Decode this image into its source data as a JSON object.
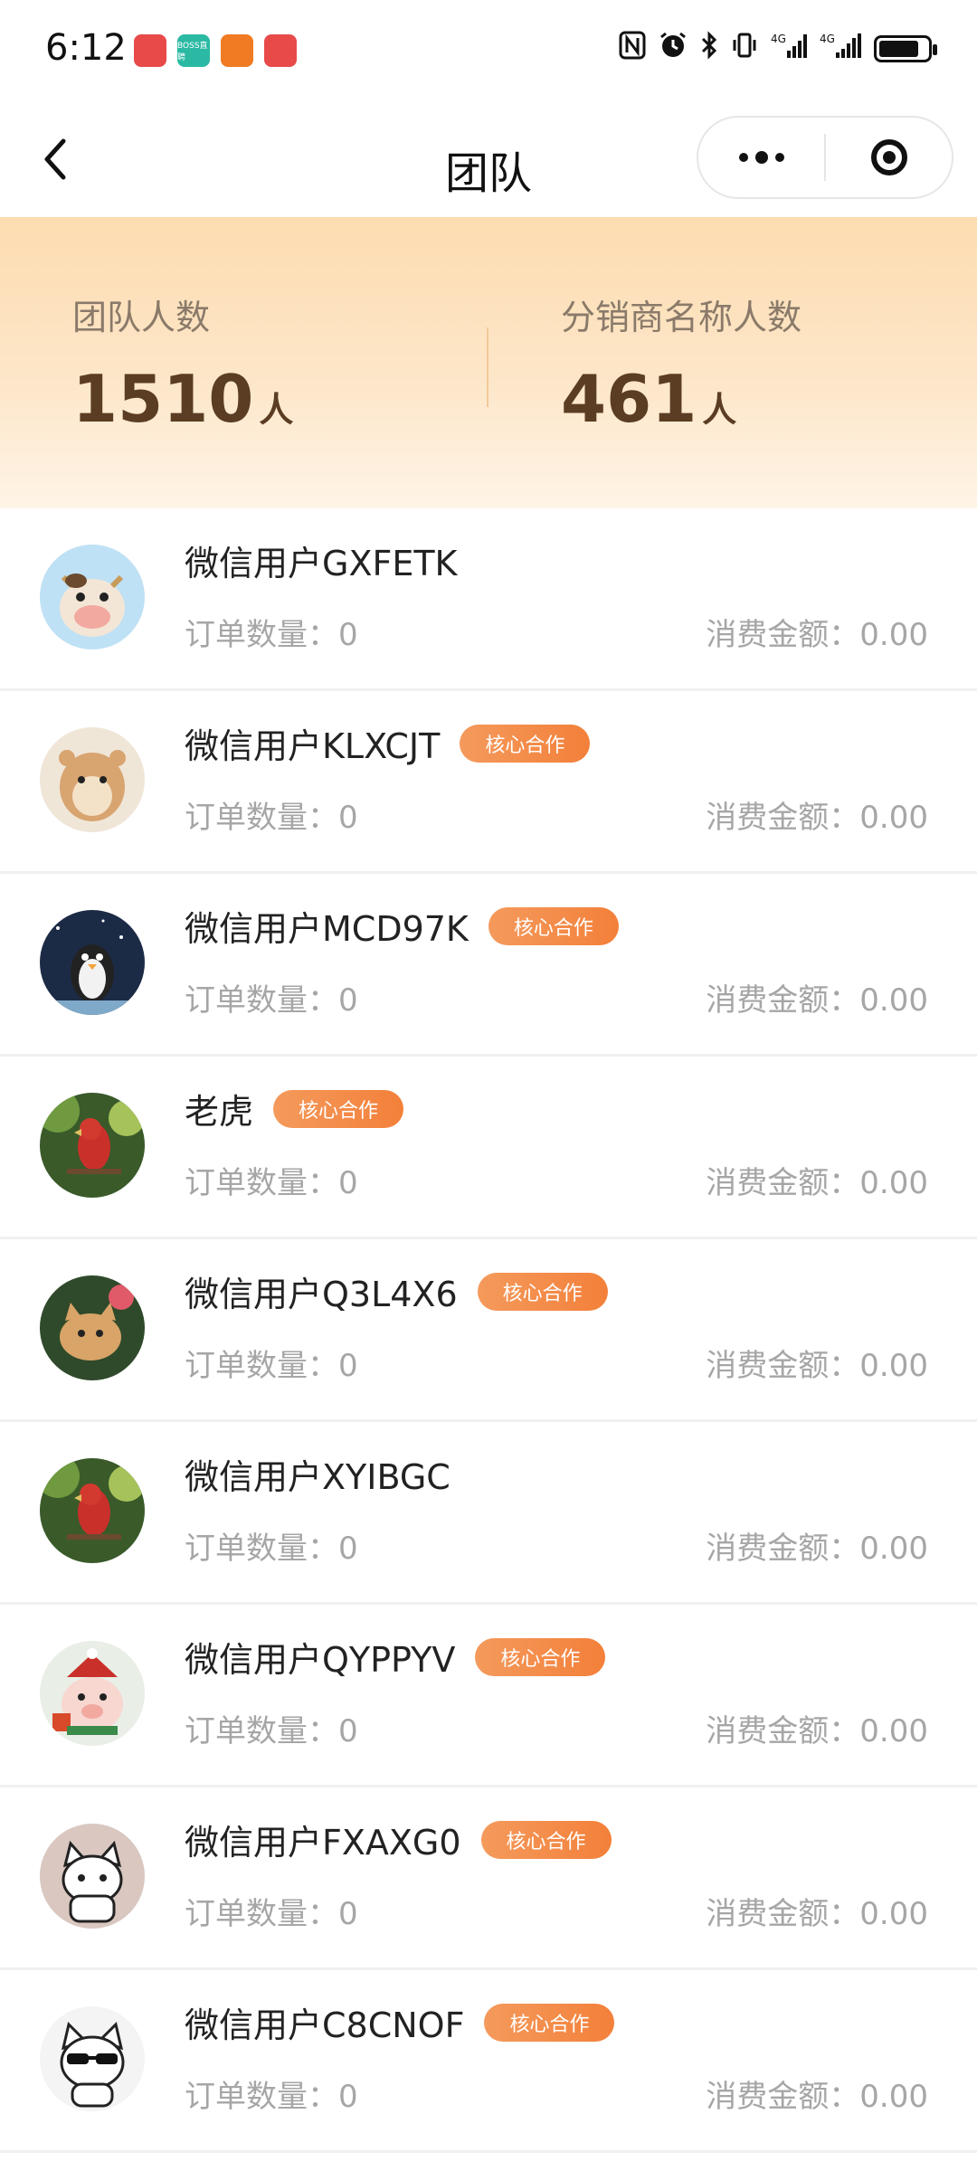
{
  "status_bar": {
    "time": "6:12",
    "apps": [
      {
        "name": "red-app",
        "color": "#e84a4a",
        "text": ""
      },
      {
        "name": "boss-app",
        "color": "#2bb9a3",
        "text": "BOSS直聘"
      },
      {
        "name": "orange-app",
        "color": "#f07b22",
        "text": ""
      },
      {
        "name": "huawei-app",
        "color": "#e84a4a",
        "text": ""
      }
    ],
    "signal_1": "4G",
    "signal_2": "4G",
    "battery_level": 0.8
  },
  "nav": {
    "title": "团队"
  },
  "summary": {
    "team_label": "团队人数",
    "team_value": "1510",
    "team_unit": "人",
    "dist_label": "分销商名称人数",
    "dist_value": "461",
    "dist_unit": "人"
  },
  "labels": {
    "orders": "订单数量：",
    "amount": "消费金额："
  },
  "members": [
    {
      "name": "微信用户GXFETK",
      "badge": "",
      "orders_label": "订单数量：",
      "orders": "0",
      "amount_label": "消费金额：",
      "amount": "0.00",
      "avatar": "cow-avatar"
    },
    {
      "name": "微信用户KLXCJT",
      "badge": "核心合作",
      "orders_label": "订单数量：",
      "orders": "0",
      "amount_label": "消费金额：",
      "amount": "0.00",
      "avatar": "hamster-avatar"
    },
    {
      "name": "微信用户MCD97K",
      "badge": "核心合作",
      "orders_label": "订单数量：",
      "orders": "0",
      "amount_label": "消费金额：",
      "amount": "0.00",
      "avatar": "penguin-avatar"
    },
    {
      "name": "老虎",
      "badge": "核心合作",
      "orders_label": "订单数量：",
      "orders": "0",
      "amount_label": "消费金额：",
      "amount": "0.00",
      "avatar": "parrot-avatar"
    },
    {
      "name": "微信用户Q3L4X6",
      "badge": "核心合作",
      "orders_label": "订单数量：",
      "orders": "0",
      "amount_label": "消费金额：",
      "amount": "0.00",
      "avatar": "kitten-avatar"
    },
    {
      "name": "微信用户XYIBGC",
      "badge": "",
      "orders_label": "订单数量：",
      "orders": "0",
      "amount_label": "消费金额：",
      "amount": "0.00",
      "avatar": "parrot-avatar"
    },
    {
      "name": "微信用户QYPPYV",
      "badge": "核心合作",
      "orders_label": "订单数量：",
      "orders": "0",
      "amount_label": "消费金额：",
      "amount": "0.00",
      "avatar": "pig-avatar"
    },
    {
      "name": "微信用户FXAXG0",
      "badge": "核心合作",
      "orders_label": "订单数量：",
      "orders": "0",
      "amount_label": "消费金额：",
      "amount": "0.00",
      "avatar": "cat-avatar"
    },
    {
      "name": "微信用户C8CNOF",
      "badge": "核心合作",
      "orders_label": "订单数量：",
      "orders": "0",
      "amount_label": "消费金额：",
      "amount": "0.00",
      "avatar": "cool-cat-avatar"
    }
  ]
}
